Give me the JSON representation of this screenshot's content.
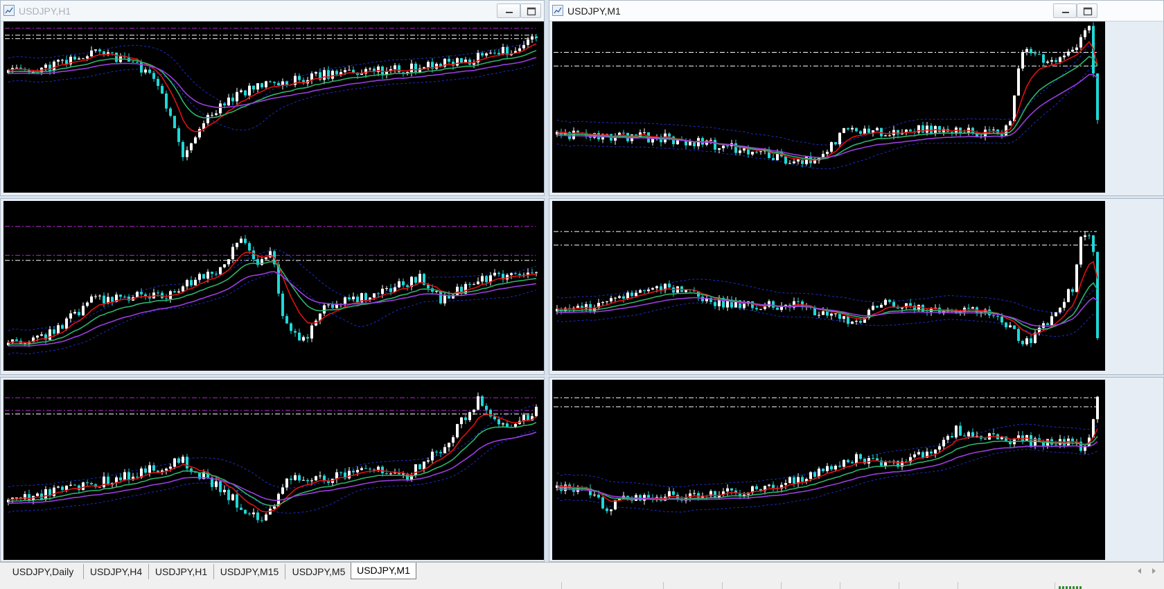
{
  "windows": [
    {
      "id": "h1",
      "title": "USDJPY,H1",
      "active": false
    },
    {
      "id": "m1",
      "title": "USDJPY,M1",
      "active": true
    }
  ],
  "charts": [
    {
      "name": "chart-usdjpy-h1",
      "seed": 11,
      "profile": [
        [
          0,
          0.3
        ],
        [
          0.07,
          0.28
        ],
        [
          0.16,
          0.18
        ],
        [
          0.24,
          0.23
        ],
        [
          0.29,
          0.4
        ],
        [
          0.33,
          0.8
        ],
        [
          0.38,
          0.55
        ],
        [
          0.45,
          0.4
        ],
        [
          0.52,
          0.36
        ],
        [
          0.62,
          0.3
        ],
        [
          0.75,
          0.28
        ],
        [
          0.88,
          0.22
        ],
        [
          0.97,
          0.15
        ],
        [
          1,
          0.08
        ]
      ],
      "hlines": [
        [
          0.04,
          "#b52bd6"
        ],
        [
          0.08,
          "#ffffff"
        ],
        [
          0.1,
          "#ffffff"
        ]
      ]
    },
    {
      "name": "chart-usdjpy-m1-1",
      "seed": 23,
      "profile": [
        [
          0,
          0.66
        ],
        [
          0.2,
          0.68
        ],
        [
          0.35,
          0.75
        ],
        [
          0.45,
          0.82
        ],
        [
          0.49,
          0.78
        ],
        [
          0.53,
          0.65
        ],
        [
          0.7,
          0.63
        ],
        [
          0.82,
          0.66
        ],
        [
          0.84,
          0.55
        ],
        [
          0.86,
          0.18
        ],
        [
          0.92,
          0.24
        ],
        [
          0.96,
          0.14
        ],
        [
          0.985,
          0.05
        ],
        [
          1,
          0.6
        ]
      ],
      "hlines": [
        [
          0.18,
          "#ffffff"
        ],
        [
          0.26,
          "#ffffff"
        ]
      ]
    },
    {
      "name": "chart-h4",
      "seed": 37,
      "profile": [
        [
          0,
          0.85
        ],
        [
          0.08,
          0.78
        ],
        [
          0.16,
          0.58
        ],
        [
          0.3,
          0.55
        ],
        [
          0.4,
          0.4
        ],
        [
          0.44,
          0.2
        ],
        [
          0.47,
          0.4
        ],
        [
          0.5,
          0.3
        ],
        [
          0.52,
          0.7
        ],
        [
          0.56,
          0.82
        ],
        [
          0.6,
          0.62
        ],
        [
          0.7,
          0.55
        ],
        [
          0.78,
          0.45
        ],
        [
          0.82,
          0.58
        ],
        [
          0.88,
          0.48
        ],
        [
          1,
          0.4
        ]
      ],
      "hlines": [
        [
          0.15,
          "#b52bd6"
        ],
        [
          0.32,
          "#b52bd6"
        ],
        [
          0.35,
          "#ffffff"
        ]
      ]
    },
    {
      "name": "chart-m1-2",
      "seed": 51,
      "profile": [
        [
          0,
          0.65
        ],
        [
          0.1,
          0.6
        ],
        [
          0.2,
          0.5
        ],
        [
          0.3,
          0.6
        ],
        [
          0.45,
          0.62
        ],
        [
          0.55,
          0.72
        ],
        [
          0.6,
          0.6
        ],
        [
          0.7,
          0.64
        ],
        [
          0.8,
          0.66
        ],
        [
          0.87,
          0.84
        ],
        [
          0.93,
          0.64
        ],
        [
          0.955,
          0.5
        ],
        [
          0.97,
          0.2
        ],
        [
          0.99,
          0.18
        ],
        [
          1,
          0.8
        ]
      ],
      "hlines": [
        [
          0.18,
          "#ffffff"
        ],
        [
          0.26,
          "#ffffff"
        ]
      ]
    },
    {
      "name": "chart-daily",
      "seed": 67,
      "profile": [
        [
          0,
          0.68
        ],
        [
          0.1,
          0.62
        ],
        [
          0.2,
          0.55
        ],
        [
          0.33,
          0.45
        ],
        [
          0.42,
          0.65
        ],
        [
          0.48,
          0.8
        ],
        [
          0.53,
          0.55
        ],
        [
          0.6,
          0.55
        ],
        [
          0.7,
          0.48
        ],
        [
          0.75,
          0.55
        ],
        [
          0.82,
          0.38
        ],
        [
          0.89,
          0.12
        ],
        [
          0.93,
          0.28
        ],
        [
          1,
          0.18
        ]
      ],
      "hlines": [
        [
          0.1,
          "#b52bd6"
        ],
        [
          0.17,
          "#b52bd6"
        ],
        [
          0.19,
          "#ffffff"
        ]
      ]
    },
    {
      "name": "chart-m1-3",
      "seed": 83,
      "profile": [
        [
          0,
          0.6
        ],
        [
          0.06,
          0.62
        ],
        [
          0.09,
          0.72
        ],
        [
          0.14,
          0.65
        ],
        [
          0.3,
          0.64
        ],
        [
          0.45,
          0.56
        ],
        [
          0.55,
          0.44
        ],
        [
          0.62,
          0.48
        ],
        [
          0.7,
          0.4
        ],
        [
          0.74,
          0.28
        ],
        [
          0.8,
          0.32
        ],
        [
          0.88,
          0.34
        ],
        [
          0.95,
          0.35
        ],
        [
          0.98,
          0.38
        ],
        [
          1,
          0.1
        ]
      ],
      "hlines": [
        [
          0.1,
          "#ffffff"
        ],
        [
          0.15,
          "#ffffff"
        ]
      ]
    }
  ],
  "tabs": [
    {
      "label": "USDJPY,Daily"
    },
    {
      "label": "USDJPY,H4"
    },
    {
      "label": "USDJPY,H1"
    },
    {
      "label": "USDJPY,M15"
    },
    {
      "label": "USDJPY,M5"
    },
    {
      "label": "USDJPY,M1",
      "active": true
    }
  ],
  "icons": {
    "window_icon": "chart-window-icon",
    "minimize": "minimize-icon",
    "maximize": "maximize-icon",
    "scroll_left": "scroll-left-icon",
    "scroll_right": "scroll-right-icon",
    "connection": "connection-status-icon"
  },
  "colors": {
    "chart_bg": "#000000",
    "candle_up": "#ffffff",
    "candle_down": "#20d8d8",
    "ma_fast": "#e01010",
    "ma_mid": "#2db36b",
    "ma_slow": "#9b3de0",
    "band": "#1a2fc8",
    "connection": "#2e8b2e"
  }
}
